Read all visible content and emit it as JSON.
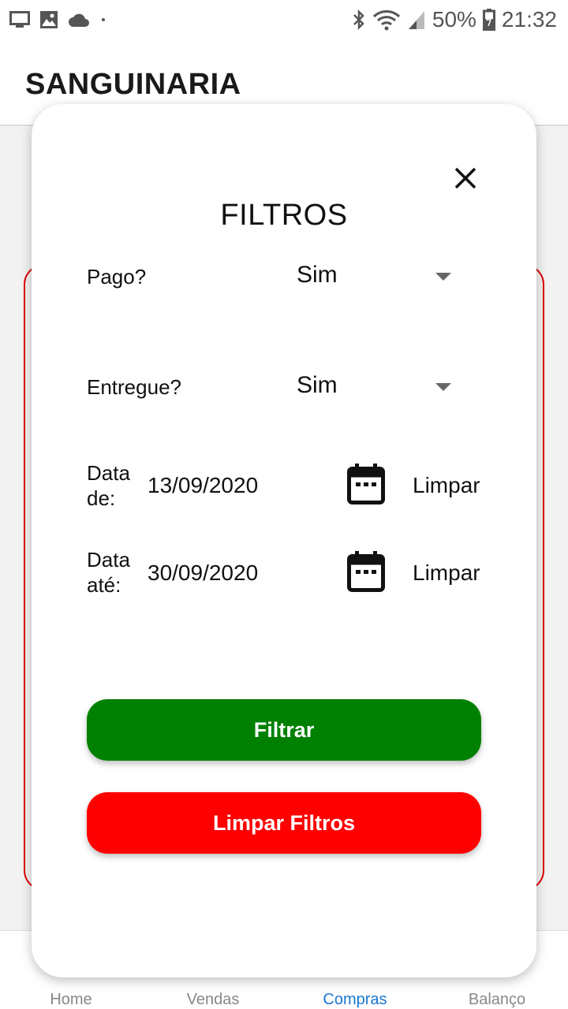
{
  "status_bar": {
    "battery": "50%",
    "time": "21:32",
    "left_icons": [
      "monitor-icon",
      "image-icon",
      "cloud-icon",
      "dot-icon"
    ],
    "right_icons": [
      "bluetooth-icon",
      "wifi-icon",
      "signal-icon",
      "battery-icon"
    ]
  },
  "app_bar": {
    "title": "SANGUINARIA"
  },
  "bottom_nav": {
    "items": [
      {
        "label": "Home",
        "active": false
      },
      {
        "label": "Vendas",
        "active": false
      },
      {
        "label": "Compras",
        "active": true
      },
      {
        "label": "Balanço",
        "active": false
      }
    ]
  },
  "modal": {
    "title": "FILTROS",
    "close_icon": "close-icon",
    "pago": {
      "label": "Pago?",
      "value": "Sim"
    },
    "entregue": {
      "label": "Entregue?",
      "value": "Sim"
    },
    "date_from": {
      "label_line1": "Data",
      "label_line2": "de:",
      "value": "13/09/2020",
      "clear": "Limpar",
      "icon": "calendar-icon"
    },
    "date_to": {
      "label_line1": "Data",
      "label_line2": "até:",
      "value": "30/09/2020",
      "clear": "Limpar",
      "icon": "calendar-icon"
    },
    "filter_button": "Filtrar",
    "clear_filters_button": "Limpar Filtros"
  },
  "colors": {
    "filter_button": "#008000",
    "clear_button": "#ff0000",
    "card_border": "#e00000",
    "active_nav": "#1976d2"
  }
}
